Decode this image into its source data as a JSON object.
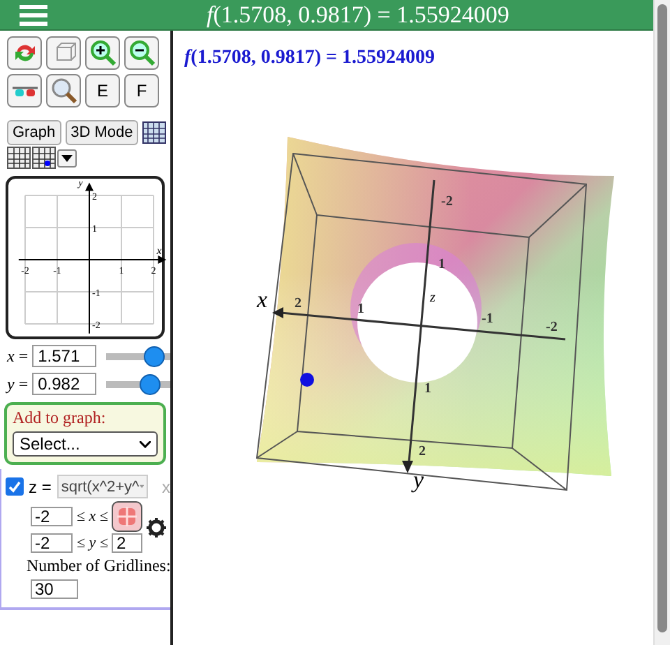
{
  "header": {
    "title": "*f*(1.5708, 0.9817) = 1.55924009"
  },
  "toolbar": {
    "letter_buttons": [
      "E",
      "F"
    ]
  },
  "mode_buttons": [
    "Graph",
    "3D Mode"
  ],
  "mini_graph": {
    "x_ticks": [
      "-2",
      "-1",
      "1",
      "2"
    ],
    "y_ticks": [
      "2",
      "1",
      "-1",
      "-2"
    ],
    "x_label": "x",
    "y_label": "y"
  },
  "variables": [
    {
      "name": "*x* =",
      "value": "1.571",
      "level": 0.88
    },
    {
      "name": "*y* =",
      "value": "0.982",
      "level": 0.78
    }
  ],
  "add_to_graph": {
    "label": "Add to graph:",
    "select": "Select..."
  },
  "function": {
    "checked": true,
    "lhs": "z =",
    "expression": "sqrt(x^2+y^",
    "remove": "x",
    "x_min": "-2",
    "x_range": "≤ *x* ≤",
    "y_min": "-2",
    "y_range": "≤ *y* ≤",
    "y_max": "2",
    "gridlines_label": "Number of Gridlines:",
    "gridlines": "30"
  },
  "result": "*f*(1.5708, 0.9817) = 1.55924009",
  "plot": {
    "axis_labels": [
      "x",
      "y",
      "z"
    ],
    "tick_labels": [
      "2",
      "1",
      "-1",
      "-2",
      "-2",
      "1",
      "2",
      "1"
    ]
  }
}
